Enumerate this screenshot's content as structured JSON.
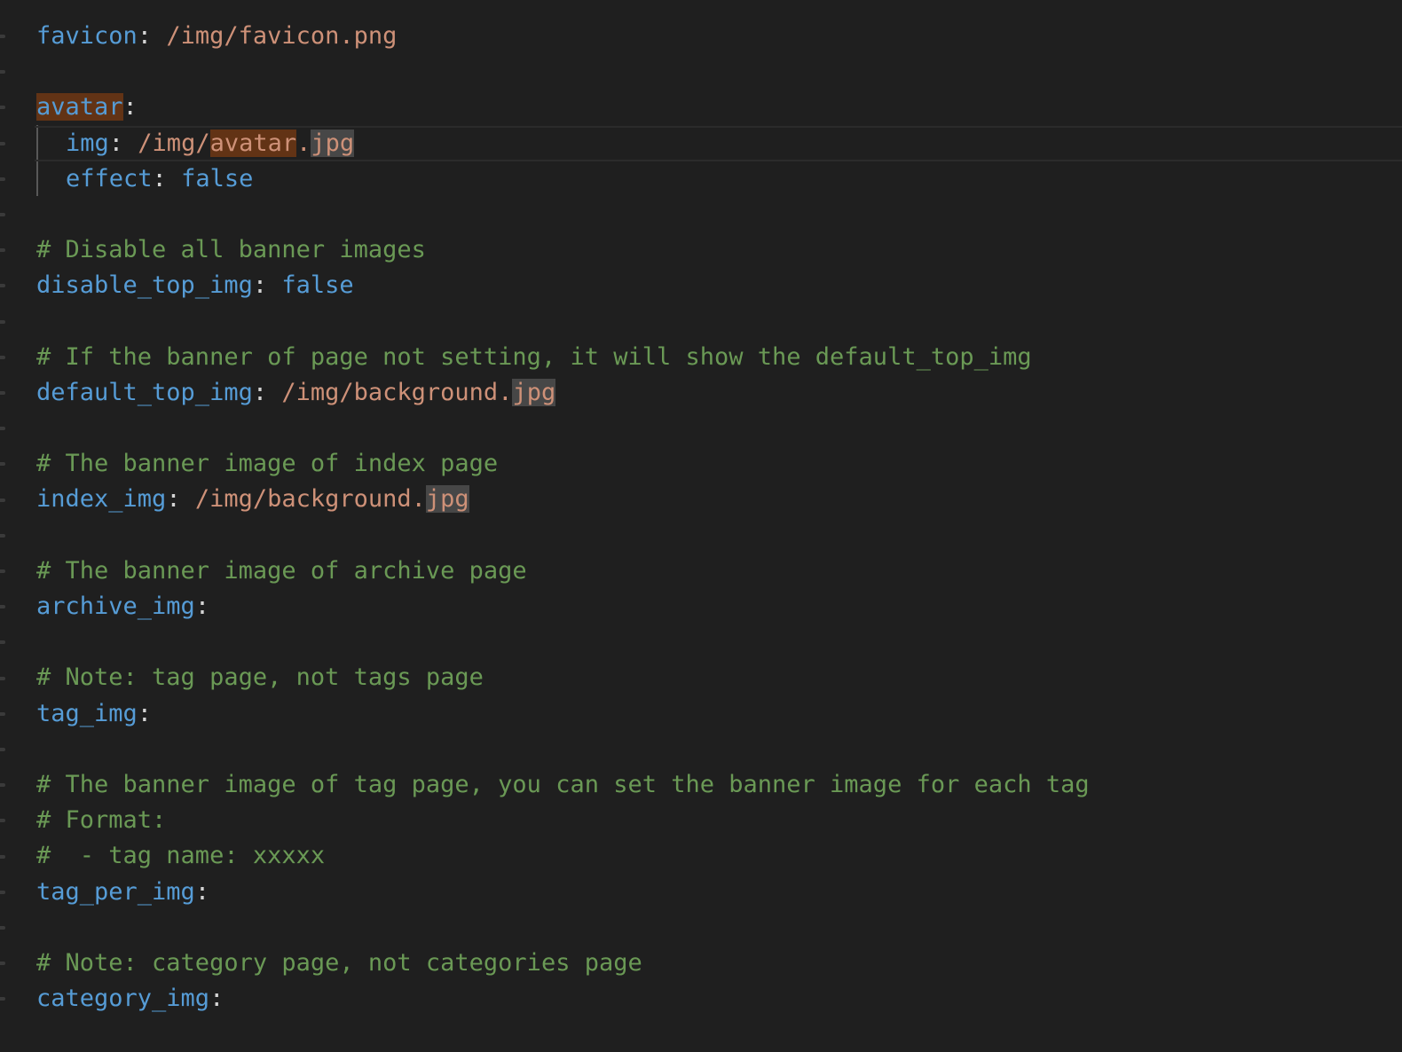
{
  "editor": {
    "language": "yaml",
    "lines": [
      {
        "type": "kv",
        "key": "favicon",
        "value": "/img/favicon.png"
      },
      {
        "type": "blank"
      },
      {
        "type": "key-only",
        "key": "avatar",
        "key_highlight": "avatar"
      },
      {
        "type": "kv-indent",
        "key": "img",
        "value_prefix": "/img/",
        "value_highlight": "avatar",
        "value_dot": ".",
        "value_selected": "jpg"
      },
      {
        "type": "kv-indent-bool",
        "key": "effect",
        "value": "false"
      },
      {
        "type": "blank"
      },
      {
        "type": "comment",
        "text": "# Disable all banner images"
      },
      {
        "type": "kv-bool",
        "key": "disable_top_img",
        "value": "false"
      },
      {
        "type": "blank"
      },
      {
        "type": "comment",
        "text": "# If the banner of page not setting, it will show the default_top_img"
      },
      {
        "type": "kv-sel",
        "key": "default_top_img",
        "value_prefix": "/img/background.",
        "value_selected": "jpg"
      },
      {
        "type": "blank"
      },
      {
        "type": "comment",
        "text": "# The banner image of index page"
      },
      {
        "type": "kv-sel",
        "key": "index_img",
        "value_prefix": "/img/background.",
        "value_selected": "jpg"
      },
      {
        "type": "blank"
      },
      {
        "type": "comment",
        "text": "# The banner image of archive page"
      },
      {
        "type": "key-only",
        "key": "archive_img"
      },
      {
        "type": "blank"
      },
      {
        "type": "comment",
        "text": "# Note: tag page, not tags page"
      },
      {
        "type": "key-only",
        "key": "tag_img"
      },
      {
        "type": "blank"
      },
      {
        "type": "comment",
        "text": "# The banner image of tag page, you can set the banner image for each tag"
      },
      {
        "type": "comment",
        "text": "# Format:"
      },
      {
        "type": "comment",
        "text": "#  - tag name: xxxxx"
      },
      {
        "type": "key-only",
        "key": "tag_per_img"
      },
      {
        "type": "blank"
      },
      {
        "type": "comment",
        "text": "# Note: category page, not categories page"
      },
      {
        "type": "key-only",
        "key": "category_img"
      }
    ]
  },
  "colors": {
    "background": "#1f1f1f",
    "key": "#569cd6",
    "string": "#ce9178",
    "comment": "#6a9955",
    "word_highlight": "#623315",
    "selection_highlight": "#474747"
  }
}
